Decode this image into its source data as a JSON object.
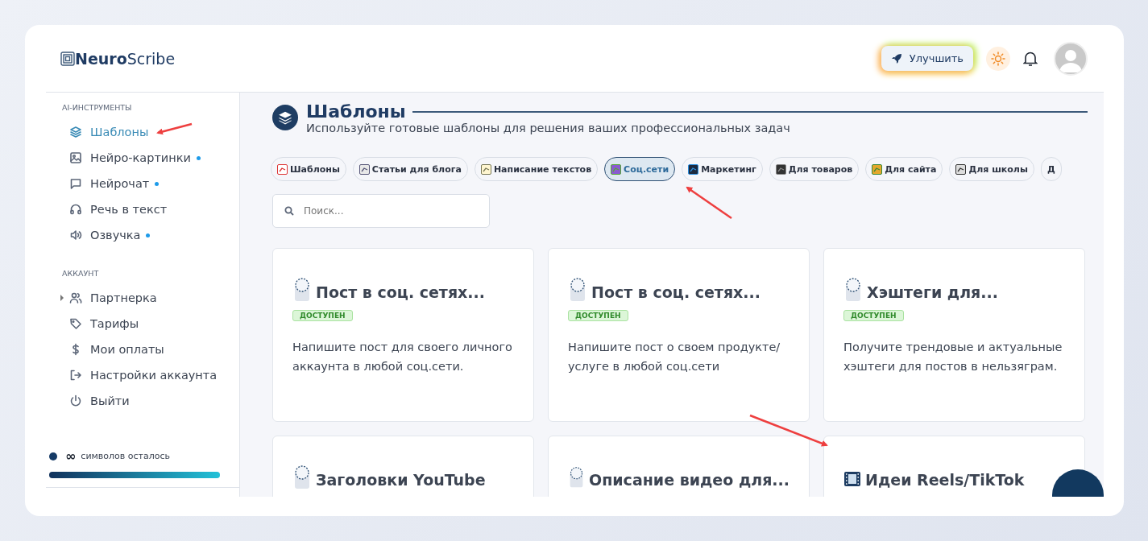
{
  "header": {
    "logo": "**Neuro**Scribe",
    "upgrade_button": "Улучшить"
  },
  "sidebar": {
    "sections": [
      {
        "title": "AI-ИНСТРУМЕНТЫ",
        "items": [
          {
            "label": "Шаблоны",
            "selected": true,
            "new_dot": false
          },
          {
            "label": "Нейро-картинки",
            "selected": false,
            "new_dot": true
          },
          {
            "label": "Нейрочат",
            "selected": false,
            "new_dot": true
          },
          {
            "label": "Речь в текст",
            "selected": false,
            "new_dot": false
          },
          {
            "label": "Озвучка",
            "selected": false,
            "new_dot": true
          }
        ]
      },
      {
        "title": "АККАУНТ",
        "items": [
          {
            "label": "Партнерка",
            "selected": false,
            "new_dot": false,
            "expanded": false
          },
          {
            "label": "Тарифы",
            "selected": false,
            "new_dot": false
          },
          {
            "label": "Мои оплаты",
            "selected": false,
            "new_dot": false
          },
          {
            "label": "Настройки аккаунта",
            "selected": false,
            "new_dot": false
          },
          {
            "label": "Выйти",
            "selected": false,
            "new_dot": false
          }
        ]
      }
    ],
    "usage": {
      "count": "∞",
      "label": "символов осталось",
      "level": 1
    }
  },
  "main": {
    "title": "Шаблоны",
    "subtitle": "Используйте готовые шаблоны для решения ваших профессиональных задач",
    "categories": [
      {
        "label": "Шаблоны",
        "selected": false
      },
      {
        "label": "Статьи для блога",
        "selected": false
      },
      {
        "label": "Написание текстов",
        "selected": false
      },
      {
        "label": "Соц.сети",
        "selected": true
      },
      {
        "label": "Маркетинг",
        "selected": false
      },
      {
        "label": "Для товаров",
        "selected": false
      },
      {
        "label": "Для сайта",
        "selected": false
      },
      {
        "label": "Для школы",
        "selected": false
      },
      {
        "label": "Д",
        "selected": false
      }
    ],
    "search": {
      "placeholder": "Поиск..."
    },
    "cards": [
      {
        "kind": "document",
        "title": "Пост в соц. сетях...",
        "badge": "ДОСТУПЕН",
        "description": "Напишите пост для своего личного аккаунта в любой соц.сети."
      },
      {
        "kind": "document",
        "title": "Пост в соц. сетях...",
        "badge": "ДОСТУПЕН",
        "description": "Напишите пост о своем продукте/ услуге в любой соц.сети"
      },
      {
        "kind": "document",
        "title": "Хэштеги для...",
        "badge": "ДОСТУПЕН",
        "description": "Получите трендовые и актуальные хэштеги для постов в нельзяграм."
      },
      {
        "kind": "document",
        "title": "Заголовки YouTube"
      },
      {
        "kind": "document",
        "title": "Описание видео для..."
      },
      {
        "kind": "film",
        "title": "Идеи Reels/TikTok"
      }
    ]
  }
}
